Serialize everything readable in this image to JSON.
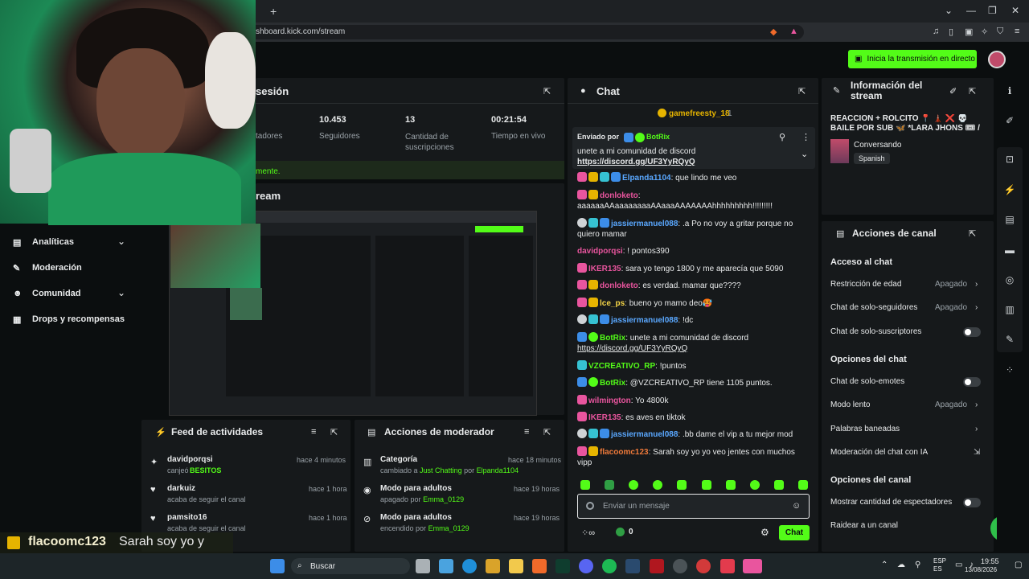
{
  "browser": {
    "new_tab": "+",
    "url": "shboard.kick.com/stream",
    "win_min": "—",
    "win_max": "❐",
    "win_close": "✕"
  },
  "header": {
    "go_live": "Inicia la transmisión en directo"
  },
  "session": {
    "title": "sesión",
    "stats": [
      {
        "value": "",
        "label": "tadores"
      },
      {
        "value": "10.453",
        "label": "Seguidores"
      },
      {
        "value": "13",
        "label": "Cantidad de suscripciones"
      },
      {
        "value": "00:21:54",
        "label": "Tiempo en vivo"
      }
    ],
    "note": "mente."
  },
  "stream": {
    "title": "ream"
  },
  "sidebar": {
    "items": [
      {
        "label": "Analíticas",
        "chevron": true
      },
      {
        "label": "Moderación",
        "chevron": false
      },
      {
        "label": "Comunidad",
        "chevron": true
      },
      {
        "label": "Drops y recompensas",
        "chevron": false
      }
    ]
  },
  "activity": {
    "title": "Feed de actividades",
    "items": [
      {
        "user": "davidporqsi",
        "time": "hace 4 minutos",
        "action": "canjeó",
        "detail": "BESITOS"
      },
      {
        "user": "darkuiz",
        "time": "hace 1 hora",
        "action": "acaba de seguir el canal",
        "detail": ""
      },
      {
        "user": "pamsito16",
        "time": "hace 1 hora",
        "action": "acaba de seguir el canal",
        "detail": ""
      }
    ]
  },
  "modactions": {
    "title": "Acciones de moderador",
    "items": [
      {
        "title": "Categoría",
        "time": "hace 18 minutos",
        "pre": "cambiado a",
        "a": "Just Chatting",
        "mid": "por",
        "b": "Elpanda1104"
      },
      {
        "title": "Modo para adultos",
        "time": "hace 19 horas",
        "pre": "apagado por",
        "a": "Emma_0129",
        "mid": "",
        "b": ""
      },
      {
        "title": "Modo para adultos",
        "time": "hace 19 horas",
        "pre": "encendido por",
        "a": "Emma_0129",
        "mid": "",
        "b": ""
      }
    ]
  },
  "chat": {
    "title": "Chat",
    "gifter": "gamefreesty_18",
    "gifter_count": "1",
    "pinned": {
      "by_label": "Enviado por",
      "by_user": "BotRix",
      "text": "unete a mi comunidad de discord",
      "link": "https://discord.gg/UF3YyRQyQ"
    },
    "messages": [
      {
        "user": "Elpanda1104",
        "color": "u-blue",
        "text": ": que lindo me veo"
      },
      {
        "user": "donloketo",
        "color": "u-pink",
        "text": ":"
      },
      {
        "user": "",
        "color": "",
        "text": "aaaaaaAAaaaaaaaaAAaaaAAAAAAAhhhhhhhhh!!!!!!!!!"
      },
      {
        "user": "jassiermanuel088",
        "color": "u-blue",
        "text": ": .a Po no voy a gritar porque no"
      },
      {
        "user": "",
        "color": "",
        "text": "quiero mamar"
      },
      {
        "user": "davidporqsi",
        "color": "u-pink",
        "text": ": ! pontos390"
      },
      {
        "user": "IKER135",
        "color": "u-pink",
        "text": ": sara yo tengo 1800 y me aparecía que 5090"
      },
      {
        "user": "donloketo",
        "color": "u-pink",
        "text": ": es verdad. mamar que????"
      },
      {
        "user": "lce_ps",
        "color": "u-yellow",
        "text": ": bueno yo mamo deo🥵"
      },
      {
        "user": "jassiermanuel088",
        "color": "u-blue",
        "text": ": !dc"
      },
      {
        "user": "BotRix",
        "color": "u-green",
        "text": ": unete a mi comunidad de discord"
      },
      {
        "user": "",
        "color": "",
        "text": "https://discord.gg/UF3YyRQyQ"
      },
      {
        "user": "VZCREATIVO_RP",
        "color": "u-green",
        "text": ": !puntos"
      },
      {
        "user": "BotRix",
        "color": "u-green",
        "text": ": @VZCREATIVO_RP tiene 1105 puntos."
      },
      {
        "user": "wilmington",
        "color": "u-pink",
        "text": ": Yo 4800k"
      },
      {
        "user": "IKER135",
        "color": "u-pink",
        "text": ": es aves en tiktok"
      },
      {
        "user": "jassiermanuel088",
        "color": "u-blue",
        "text": ": .bb dame el vip a tu mejor mod"
      },
      {
        "user": "flacoomc123",
        "color": "u-orange",
        "text": ": Sarah soy yo yo veo jentes con muchos"
      },
      {
        "user": "",
        "color": "",
        "text": "vipp"
      }
    ],
    "input_placeholder": "Enviar un mensaje",
    "points": "0",
    "send": "Chat"
  },
  "info": {
    "title": "Información del stream",
    "stream_title": "REACCION + ROLCITO 📍 🗼 ❌ 💀 BAILE POR SUB 🦋 *LARA JHONS 🎟 / / ...SIN...",
    "category": "Conversando",
    "language": "Spanish"
  },
  "channel": {
    "title": "Acciones de canal",
    "sections": [
      {
        "header": "Acceso al chat",
        "rows": [
          {
            "label": "Restricción de edad",
            "value": "Apagado",
            "kind": "chevron"
          },
          {
            "label": "Chat de solo-seguidores",
            "value": "Apagado",
            "kind": "chevron"
          },
          {
            "label": "Chat de solo-suscriptores",
            "value": "",
            "kind": "toggle"
          }
        ]
      },
      {
        "header": "Opciones del chat",
        "rows": [
          {
            "label": "Chat de solo-emotes",
            "value": "",
            "kind": "toggle"
          },
          {
            "label": "Modo lento",
            "value": "Apagado",
            "kind": "chevron"
          },
          {
            "label": "Palabras baneadas",
            "value": "",
            "kind": "chevron"
          },
          {
            "label": "Moderación del chat con IA",
            "value": "",
            "kind": "external"
          }
        ]
      },
      {
        "header": "Opciones del canal",
        "rows": [
          {
            "label": "Mostrar cantidad de espectadores",
            "value": "",
            "kind": "toggle"
          },
          {
            "label": "Raidear a un canal",
            "value": "",
            "kind": "none"
          }
        ]
      }
    ]
  },
  "overlay": {
    "user": "flacoomc123",
    "text": "Sarah soy yo y"
  },
  "taskbar": {
    "search": "Buscar",
    "lang": "ESP",
    "region": "ES",
    "time": "19:55",
    "date": "13/08/2026"
  },
  "colors": {
    "accent": "#53fc18",
    "panel": "#16191b",
    "bg": "#0b0e0f"
  }
}
